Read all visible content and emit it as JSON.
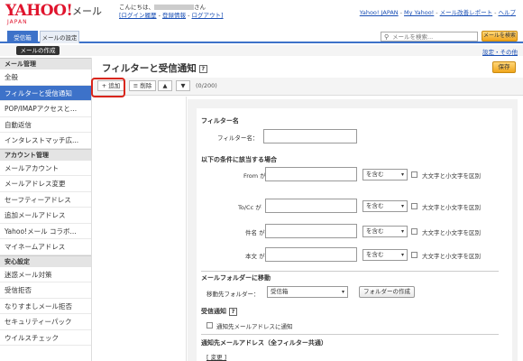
{
  "header": {
    "logo_text": "YAHOO!",
    "logo_sub": "JAPAN",
    "app_name": "メール",
    "greeting": "こんにちは、",
    "greeting_suffix": "さん",
    "login_history": "[ログイン履歴",
    "register_info": "登録情報",
    "logout": "ログアウト]",
    "top_links": [
      "Yahoo! JAPAN",
      "My Yahoo!",
      "メール改善レポート",
      "ヘルプ"
    ]
  },
  "tabs": [
    {
      "label": "受信箱"
    },
    {
      "label": "メールの設定"
    }
  ],
  "search": {
    "placeholder": "メールを検索...",
    "button": "メールを検索"
  },
  "compose": {
    "label": "メールの作成"
  },
  "settings_link": "設定・その他",
  "sidebar": {
    "sections": [
      {
        "title": "メール管理",
        "items": [
          "全般",
          "フィルターと受信通知",
          "POP/IMAPアクセスと...",
          "自動返信",
          "インタレストマッチ広..."
        ]
      },
      {
        "title": "アカウント管理",
        "items": [
          "メールアカウント",
          "メールアドレス変更",
          "セーフティーアドレス",
          "追加メールアドレス",
          "Yahoo!メール コラボ...",
          "マイネームアドレス"
        ]
      },
      {
        "title": "安心設定",
        "items": [
          "迷惑メール対策",
          "受信拒否",
          "なりすましメール拒否",
          "セキュリティーパック",
          "ウイルスチェック"
        ]
      }
    ]
  },
  "main": {
    "title": "フィルターと受信通知",
    "save": "保存",
    "toolbar": {
      "add": "追加",
      "delete": "削除",
      "up": "▲",
      "down": "▼",
      "count": "(0/200)"
    }
  },
  "form": {
    "filter_name_heading": "フィルター名",
    "filter_name_label": "フィルター名：",
    "conditions_heading": "以下の条件に該当する場合",
    "conditions": [
      {
        "label": "From が",
        "match": "を含む",
        "case_label": "大文字と小文字を区別"
      },
      {
        "label": "To/Cc が",
        "match": "を含む",
        "case_label": "大文字と小文字を区別"
      },
      {
        "label": "件名 が",
        "match": "を含む",
        "case_label": "大文字と小文字を区別"
      },
      {
        "label": "本文 が",
        "match": "を含む",
        "case_label": "大文字と小文字を区別"
      }
    ],
    "move_heading": "メールフォルダーに移動",
    "move_label": "移動先フォルダー：",
    "move_folder": "受信箱",
    "create_folder": "フォルダーの作成",
    "notify_heading": "受信通知",
    "notify_checkbox": "通知先メールアドレスに通知",
    "notify_address_heading": "通知先メールアドレス（全フィルター共通）",
    "change_link": "[ 変更 ]"
  }
}
